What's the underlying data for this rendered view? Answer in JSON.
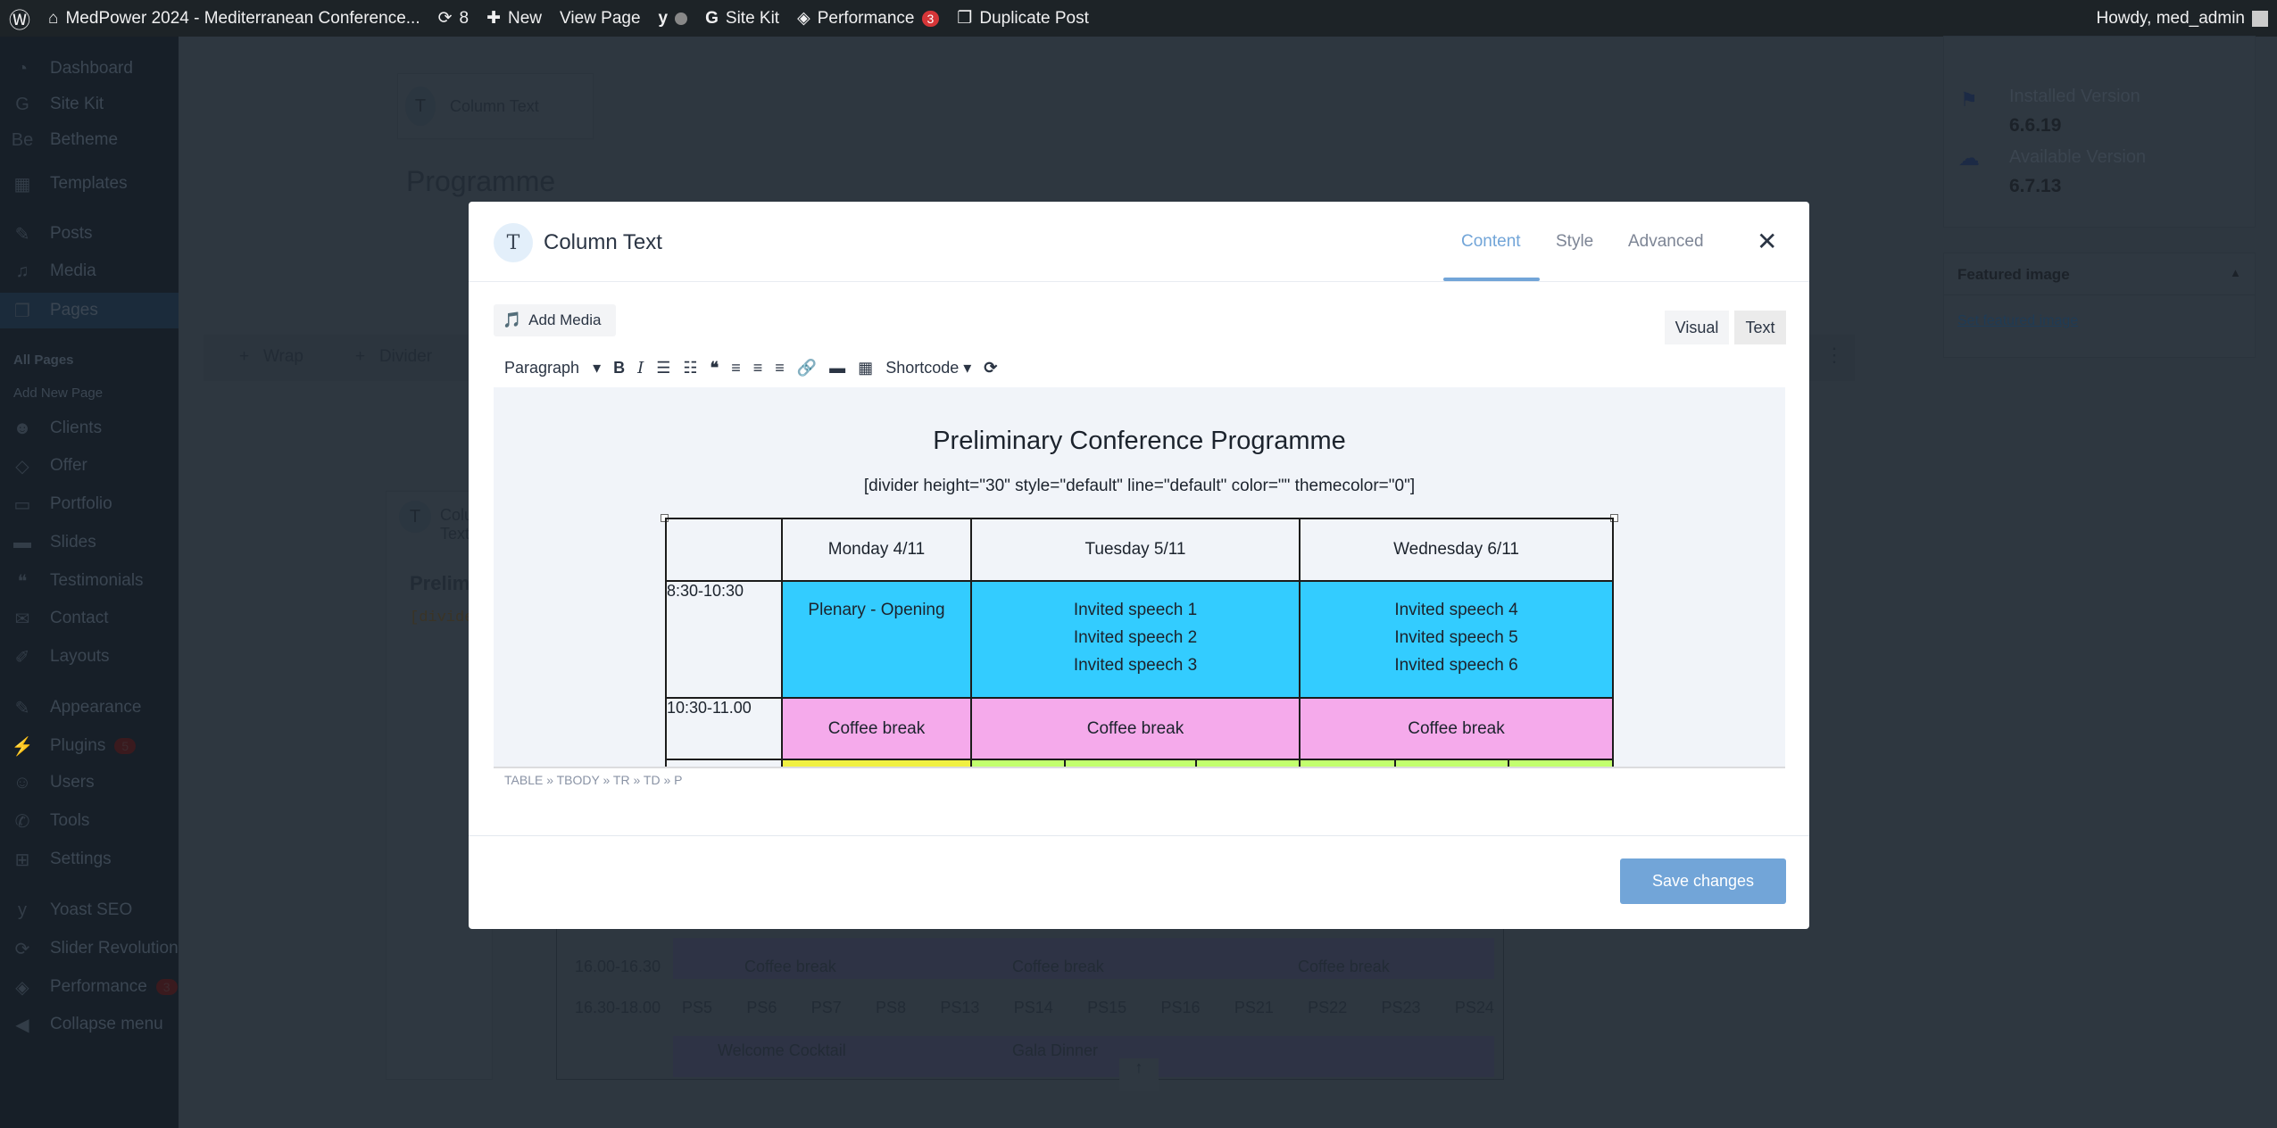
{
  "adminbar": {
    "site_title": "MedPower 2024 - Mediterranean Conference...",
    "updates_count": "8",
    "new_label": "New",
    "view_page": "View Page",
    "site_kit": "Site Kit",
    "performance": "Performance",
    "performance_badge": "3",
    "duplicate_post": "Duplicate Post",
    "howdy": "Howdy, med_admin"
  },
  "sidebar": {
    "items": [
      {
        "label": "Dashboard",
        "icon": "dashboard-icon"
      },
      {
        "label": "Site Kit",
        "icon": "google-icon"
      },
      {
        "label": "Betheme",
        "icon": "betheme-icon"
      },
      {
        "label": "Templates",
        "icon": "templates-icon"
      },
      {
        "label": "Posts",
        "icon": "pin-icon"
      },
      {
        "label": "Media",
        "icon": "media-icon"
      },
      {
        "label": "Pages",
        "icon": "pages-icon"
      },
      {
        "label": "Clients",
        "icon": "clients-icon"
      },
      {
        "label": "Offer",
        "icon": "offer-icon"
      },
      {
        "label": "Portfolio",
        "icon": "folder-icon"
      },
      {
        "label": "Slides",
        "icon": "slides-icon"
      },
      {
        "label": "Testimonials",
        "icon": "quote-icon"
      },
      {
        "label": "Contact",
        "icon": "mail-icon"
      },
      {
        "label": "Layouts",
        "icon": "pencil-icon"
      },
      {
        "label": "Appearance",
        "icon": "brush-icon"
      },
      {
        "label": "Plugins",
        "icon": "plugin-icon",
        "badge": "5"
      },
      {
        "label": "Users",
        "icon": "user-icon"
      },
      {
        "label": "Tools",
        "icon": "wrench-icon"
      },
      {
        "label": "Settings",
        "icon": "settings-icon"
      },
      {
        "label": "Yoast SEO",
        "icon": "yoast-icon"
      },
      {
        "label": "Slider Revolution",
        "icon": "refresh-icon"
      },
      {
        "label": "Performance",
        "icon": "performance-icon",
        "badge": "3"
      },
      {
        "label": "Collapse menu",
        "icon": "collapse-icon"
      }
    ],
    "submenu": [
      "All Pages",
      "Add New Page"
    ]
  },
  "background": {
    "card1_title": "Column Text",
    "heading": "Programme",
    "wrap": "Wrap",
    "divider": "Divider",
    "card2_title": "Column Text",
    "card2_heading": "Prelim",
    "card2_code": "[divide",
    "installed_label": "Installed Version",
    "installed_value": "6.6.19",
    "available_label": "Available Version",
    "available_value": "6.7.13",
    "featured_title": "Featured image",
    "featured_link": "Set featured image",
    "table_rows": [
      {
        "time": "16.00-16.30",
        "cells": [
          "Coffee break",
          "Coffee break",
          "Coffee break"
        ]
      },
      {
        "time": "16.30-18.00",
        "sessions": [
          "PS5",
          "PS6",
          "PS7",
          "PS8",
          "PS13",
          "PS14",
          "PS15",
          "PS16",
          "PS21",
          "PS22",
          "PS23",
          "PS24"
        ]
      },
      {
        "time": "",
        "cells": [
          "Welcome Cocktail",
          "Gala Dinner",
          ""
        ]
      }
    ]
  },
  "modal": {
    "title": "Column Text",
    "icon_letter": "T",
    "tabs": [
      "Content",
      "Style",
      "Advanced"
    ],
    "active_tab": "Content",
    "add_media": "Add Media",
    "visual": "Visual",
    "text": "Text",
    "format": "Paragraph",
    "shortcode": "Shortcode",
    "save": "Save changes",
    "path": "TABLE » TBODY » TR » TD » P"
  },
  "content": {
    "title": "Preliminary Conference Programme",
    "divider": "[divider height=\"30\" style=\"default\" line=\"default\" color=\"\" themecolor=\"0\"]",
    "headers": [
      "",
      "Monday 4/11",
      "Tuesday 5/11",
      "Wednesday 6/11"
    ],
    "row1": {
      "time": "8:30-10:30",
      "mon": "Plenary - Opening",
      "tue": [
        "Invited speech 1",
        "Invited speech 2",
        "Invited speech 3"
      ],
      "wed": [
        "Invited speech 4",
        "Invited speech 5",
        "Invited speech 6"
      ]
    },
    "row2": {
      "time": "10:30-11.00",
      "cells": [
        "Coffee break",
        "Coffee break",
        "Coffee break"
      ]
    }
  },
  "colors": {
    "accent": "#72a5d8",
    "session_blue": "#33ccff",
    "break_pink": "#f5aaeb",
    "yellow": "#f0f042",
    "green": "#c2ff6e"
  }
}
